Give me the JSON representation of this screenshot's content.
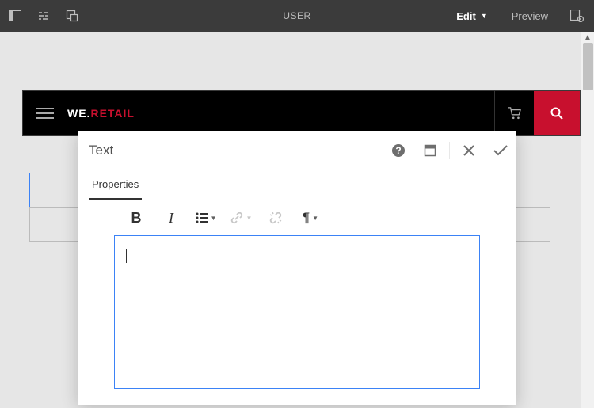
{
  "topbar": {
    "page_label": "USER",
    "mode_label": "Edit",
    "preview_label": "Preview"
  },
  "site_header": {
    "brand_left": "WE.",
    "brand_right": "RETAIL"
  },
  "dialog": {
    "title": "Text",
    "tab_label": "Properties",
    "textarea_value": ""
  },
  "colors": {
    "brand_red": "#c8102e",
    "selection_blue": "#3b82f6",
    "topbar_bg": "#3b3b3b"
  }
}
